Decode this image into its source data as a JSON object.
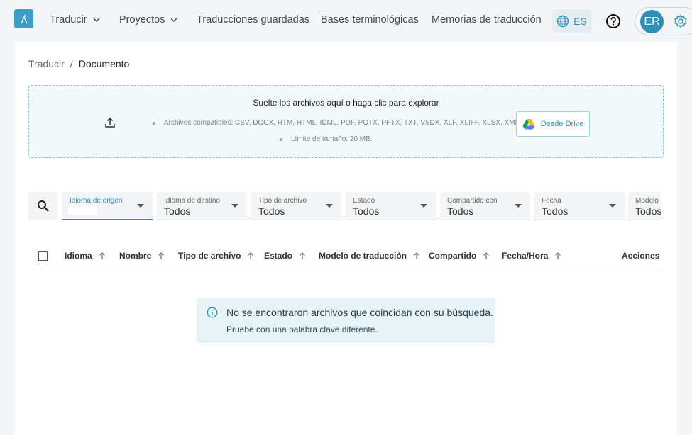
{
  "nav": {
    "items": [
      {
        "label": "Traducir",
        "dropdown": true
      },
      {
        "label": "Proyectos",
        "dropdown": true
      },
      {
        "label": "Traducciones guardadas",
        "dropdown": false
      },
      {
        "label": "Bases terminológicas",
        "dropdown": false
      },
      {
        "label": "Memorias de traducción",
        "dropdown": false
      }
    ],
    "language": "ES",
    "user_initials": "ER"
  },
  "breadcrumb": {
    "parent": "Traducir",
    "separator": "/",
    "current": "Documento"
  },
  "dropzone": {
    "title": "Suelte los archivos aquí o haga clic para explorar",
    "formats": "Archivos compatibles: CSV, DOCX, HTM, HTML, IDML, PDF, POTX, PPTX, TXT, VSDX, XLF, XLIFF, XLSX, XML",
    "size_limit": "Límite de tamaño: 20 MB.",
    "drive_button": "Desde Drive"
  },
  "filters": [
    {
      "label": "Idioma de origen",
      "value": ""
    },
    {
      "label": "Idioma de destino",
      "value": "Todos"
    },
    {
      "label": "Tipo de archivo",
      "value": "Todos"
    },
    {
      "label": "Estado",
      "value": "Todos"
    },
    {
      "label": "Compartido con",
      "value": "Todos"
    },
    {
      "label": "Fecha",
      "value": "Todos"
    },
    {
      "label": "Modelo",
      "value": "Todos"
    }
  ],
  "table": {
    "columns": [
      "Idioma",
      "Nombre",
      "Tipo de archivo",
      "Estado",
      "Modelo de traducción",
      "Compartido",
      "Fecha/Hora",
      "Acciones"
    ]
  },
  "empty": {
    "title": "No se encontraron archivos que coincidan con su búsqueda.",
    "subtitle": "Pruebe con una palabra clave diferente."
  },
  "colors": {
    "accent": "#2f93b8",
    "logo": "#3a9ec6",
    "avatar": "#2f8fb3",
    "notice_bg": "#e8f3f8"
  }
}
